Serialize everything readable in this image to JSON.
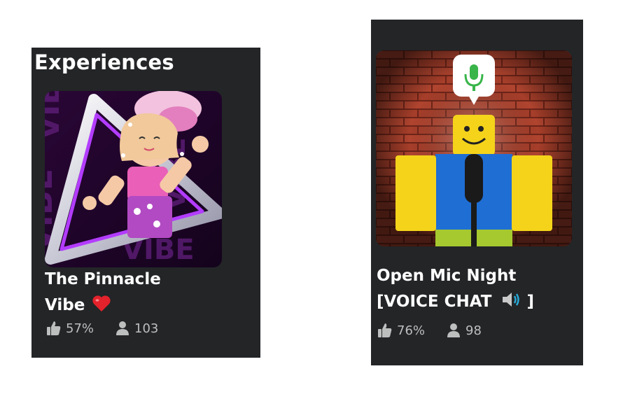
{
  "section": {
    "title": "Experiences"
  },
  "games": [
    {
      "title_line1": "The Pinnacle",
      "title_line2": "Vibe",
      "rating": "57%",
      "players": "103",
      "thumbnail_watermark": "VIBE"
    },
    {
      "title_line1": "Open Mic Night",
      "title_line2_prefix": "[VOICE CHAT",
      "title_line2_suffix": "]",
      "rating": "76%",
      "players": "98"
    }
  ],
  "icons": {
    "rating": "thumbs-up-icon",
    "players": "person-icon",
    "heart": "heart-emoji-icon",
    "speaker": "speaker-volume-icon",
    "microphone": "microphone-icon"
  },
  "colors": {
    "panel_background": "#232527",
    "title_text": "#ffffff",
    "stat_text": "#bdbebe",
    "heart": "#e3222b",
    "mic_green": "#39b54a"
  }
}
